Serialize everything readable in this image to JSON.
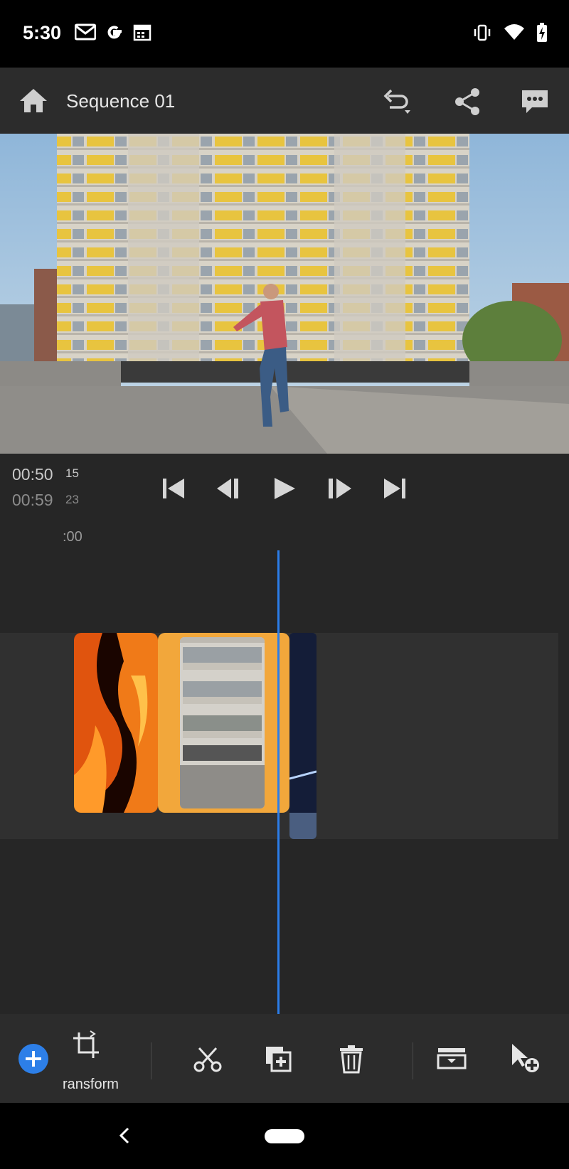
{
  "status_bar": {
    "time": "5:30",
    "left_icons": [
      "gmail-icon",
      "google-icon",
      "calendar-icon"
    ],
    "right_icons": [
      "vibrate-icon",
      "wifi-icon",
      "battery-charging-icon"
    ]
  },
  "app_bar": {
    "title": "Sequence 01",
    "icons": [
      "home-icon",
      "undo-icon",
      "share-icon",
      "comment-icon"
    ]
  },
  "transport": {
    "current_time": "00:50",
    "current_frames": "15",
    "total_time": "00:59",
    "total_frames": "23",
    "icons": [
      "skip-to-start-icon",
      "step-back-icon",
      "play-icon",
      "step-forward-icon",
      "skip-to-end-icon"
    ]
  },
  "timeline": {
    "ruler_label": ":00"
  },
  "toolbar": {
    "transform_label": "ransform",
    "icons": [
      "add-icon",
      "transform-crop-icon",
      "scissors-icon",
      "duplicate-icon",
      "trash-icon",
      "detach-audio-icon",
      "add-pointer-icon"
    ]
  },
  "colors": {
    "accent": "#2b7de9",
    "selection": "#f2a73b",
    "panel": "#2c2c2c",
    "timeline_bg": "#262626"
  }
}
